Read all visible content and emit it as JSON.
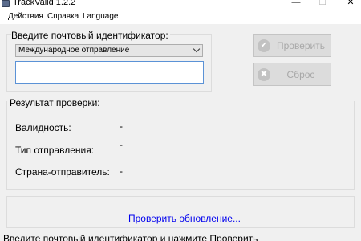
{
  "window": {
    "title": "TrackValid 1.2.2",
    "icon": "app-icon",
    "controls": {
      "minimize": "—",
      "maximize": "☐",
      "close": "✕"
    }
  },
  "menu": {
    "items": [
      "Действия",
      "Справка",
      "Language"
    ]
  },
  "input_group": {
    "label": "Введите почтовый идентификатор:",
    "select": {
      "selected": "Международное отправление",
      "icon": "chevron-down-icon"
    },
    "tracking_input": {
      "value": "",
      "placeholder": ""
    }
  },
  "buttons": {
    "check": {
      "label": "Проверить",
      "icon": "checkmark-icon",
      "glyph": "✔",
      "enabled": false
    },
    "reset": {
      "label": "Сброс",
      "icon": "cancel-icon",
      "glyph": "✖",
      "enabled": false
    }
  },
  "result": {
    "label": "Результат проверки:",
    "rows": [
      {
        "label": "Валидность:",
        "value": "-"
      },
      {
        "label": "Тип отправления:",
        "value": "-"
      },
      {
        "label": "Страна-отправитель:",
        "value": "-"
      }
    ]
  },
  "update": {
    "link": "Проверить обновление..."
  },
  "status": {
    "text": "Введите почтовый идентификатор и нажмите Проверить"
  },
  "colors": {
    "window_bg": "#f0f0f0",
    "input_focus_border": "#5b92d6",
    "link": "#0000ee",
    "disabled_text": "#a8a8a8"
  }
}
